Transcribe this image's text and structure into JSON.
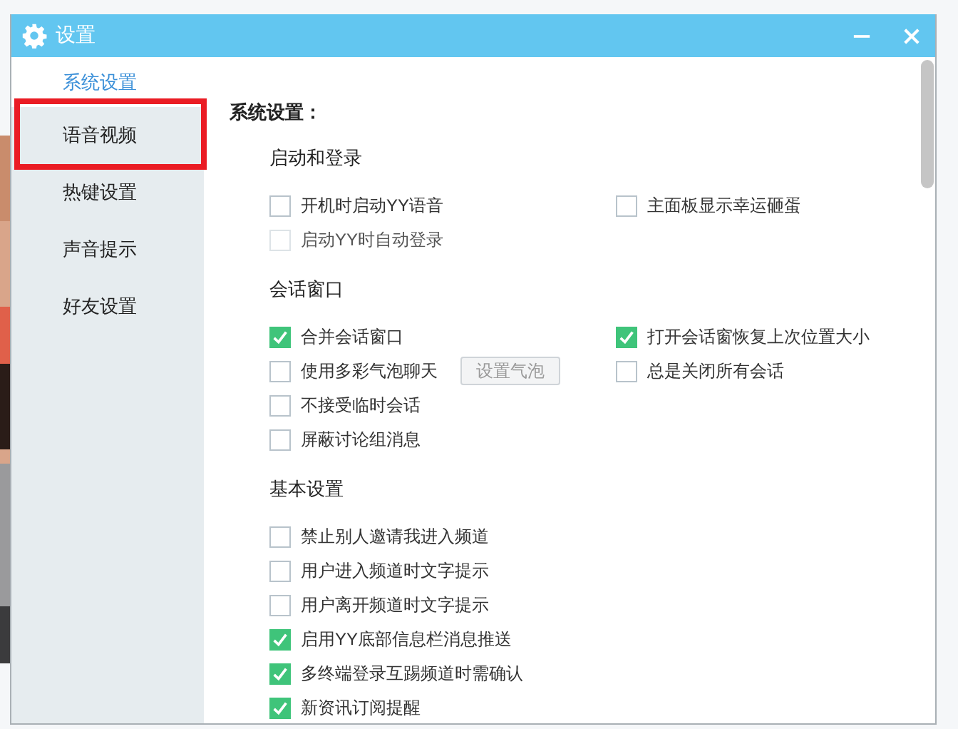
{
  "window": {
    "title": "设置"
  },
  "sidebar": {
    "items": [
      {
        "label": "系统设置",
        "selected": true,
        "highlighted": false
      },
      {
        "label": "语音视频",
        "selected": false,
        "highlighted": true
      },
      {
        "label": "热键设置",
        "selected": false,
        "highlighted": false
      },
      {
        "label": "声音提示",
        "selected": false,
        "highlighted": false
      },
      {
        "label": "好友设置",
        "selected": false,
        "highlighted": false
      }
    ]
  },
  "content": {
    "heading": "系统设置：",
    "sections": [
      {
        "title": "启动和登录",
        "rows": [
          {
            "options": [
              {
                "label": "开机时启动YY语音",
                "checked": false,
                "disabled": false
              },
              {
                "label": "主面板显示幸运砸蛋",
                "checked": false,
                "disabled": false
              }
            ]
          },
          {
            "options": [
              {
                "label": "启动YY时自动登录",
                "checked": false,
                "disabled": true
              }
            ]
          }
        ]
      },
      {
        "title": "会话窗口",
        "rows": [
          {
            "options": [
              {
                "label": "合并会话窗口",
                "checked": true,
                "disabled": false
              },
              {
                "label": "打开会话窗恢复上次位置大小",
                "checked": true,
                "disabled": false
              }
            ]
          },
          {
            "options": [
              {
                "label": "使用多彩气泡聊天",
                "checked": false,
                "disabled": false
              },
              {
                "label": "总是关闭所有会话",
                "checked": false,
                "disabled": false
              }
            ],
            "button": {
              "label": "设置气泡",
              "disabled": true
            }
          },
          {
            "options": [
              {
                "label": "不接受临时会话",
                "checked": false,
                "disabled": false
              }
            ]
          },
          {
            "options": [
              {
                "label": "屏蔽讨论组消息",
                "checked": false,
                "disabled": false
              }
            ]
          }
        ]
      },
      {
        "title": "基本设置",
        "rows": [
          {
            "options": [
              {
                "label": "禁止别人邀请我进入频道",
                "checked": false,
                "disabled": false
              }
            ]
          },
          {
            "options": [
              {
                "label": "用户进入频道时文字提示",
                "checked": false,
                "disabled": false
              }
            ]
          },
          {
            "options": [
              {
                "label": "用户离开频道时文字提示",
                "checked": false,
                "disabled": false
              }
            ]
          },
          {
            "options": [
              {
                "label": "启用YY底部信息栏消息推送",
                "checked": true,
                "disabled": false
              }
            ]
          },
          {
            "options": [
              {
                "label": "多终端登录互踢频道时需确认",
                "checked": true,
                "disabled": false
              }
            ]
          },
          {
            "options": [
              {
                "label": "新资讯订阅提醒",
                "checked": true,
                "disabled": false
              }
            ]
          }
        ]
      }
    ]
  }
}
